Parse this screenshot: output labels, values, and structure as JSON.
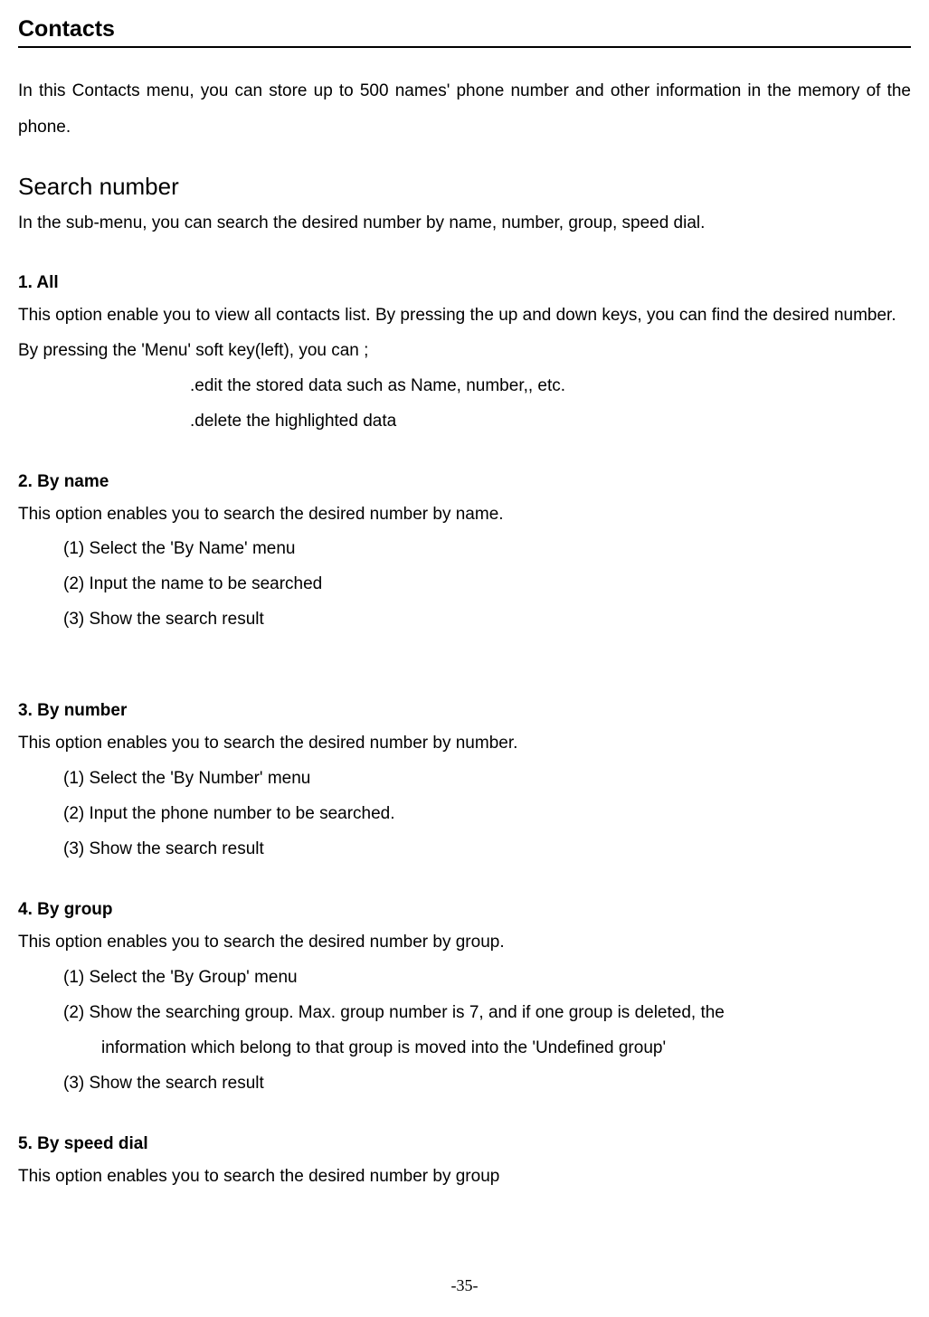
{
  "title": "Contacts",
  "intro": "In this Contacts menu, you can store up to 500 names' phone number and other information in the memory of the phone.",
  "search": {
    "heading": "Search number",
    "intro": "In the sub-menu, you can search the desired number by name, number, group, speed dial."
  },
  "section1": {
    "heading": "1. All",
    "p1": "This option enable you to view all contacts list. By pressing the up and down keys, you can find the desired number.",
    "p2": "By pressing the 'Menu' soft key(left), you can ;",
    "bullet1": ".edit the stored data such as Name, number,, etc.",
    "bullet2": ".delete the highlighted data"
  },
  "section2": {
    "heading": "2. By name",
    "p1": "This option enables you to search the desired number by name.",
    "item1": "(1) Select the 'By Name' menu",
    "item2": "(2) Input the name to be searched",
    "item3": "(3) Show the search result"
  },
  "section3": {
    "heading": "3. By number",
    "p1": "This option enables you to search the desired number by number.",
    "item1": "(1)  Select the 'By Number' menu",
    "item2": "(2)  Input the phone number to be searched.",
    "item3": "(3)  Show the search result"
  },
  "section4": {
    "heading": "4. By group",
    "p1": "This option enables you to search the desired number by group.",
    "item1": "(1) Select the 'By Group' menu",
    "item2a": "(2) Show the searching group. Max. group number is 7, and if one group is deleted, the",
    "item2b": "information which belong to that group is moved into the 'Undefined group'",
    "item3": "(3) Show the search result"
  },
  "section5": {
    "heading": "5. By speed dial",
    "p1": "This option enables you to search the desired number by group"
  },
  "pageNumber": "-35-"
}
